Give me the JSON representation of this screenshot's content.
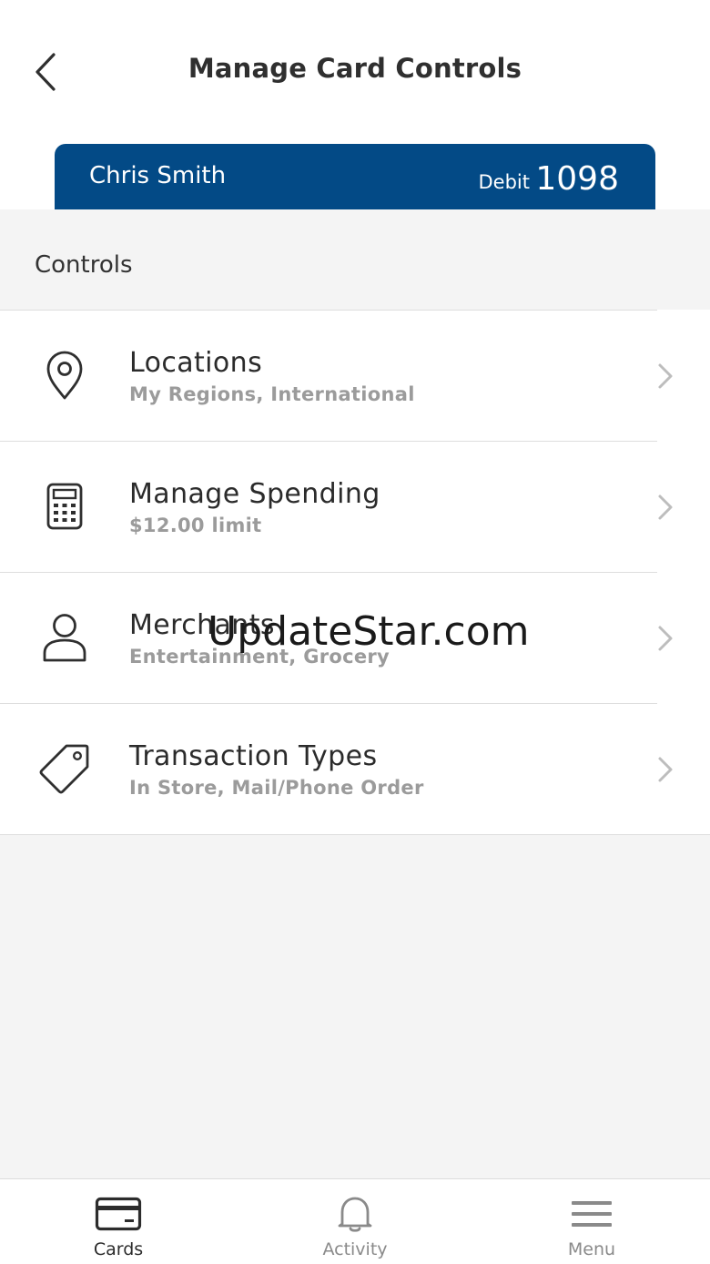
{
  "header": {
    "title": "Manage Card Controls",
    "back_icon": "chevron-left-icon"
  },
  "card": {
    "holder_name": "Chris Smith",
    "type": "Debit",
    "last_four": "1098",
    "color": "#034a86"
  },
  "controls": {
    "section_label": "Controls",
    "items": [
      {
        "title": "Locations",
        "subtitle": "My Regions, International",
        "icon": "location-pin-icon"
      },
      {
        "title": "Manage Spending",
        "subtitle": "$12.00 limit",
        "icon": "calculator-icon"
      },
      {
        "title": "Merchants",
        "subtitle": "Entertainment, Grocery",
        "icon": "person-icon"
      },
      {
        "title": "Transaction Types",
        "subtitle": "In Store, Mail/Phone Order",
        "icon": "tag-icon"
      }
    ]
  },
  "watermark": "UpdateStar.com",
  "tab_bar": {
    "tabs": [
      {
        "label": "Cards",
        "icon": "card-icon",
        "active": true
      },
      {
        "label": "Activity",
        "icon": "bell-icon",
        "active": false
      },
      {
        "label": "Menu",
        "icon": "hamburger-menu-icon",
        "active": false
      }
    ]
  }
}
